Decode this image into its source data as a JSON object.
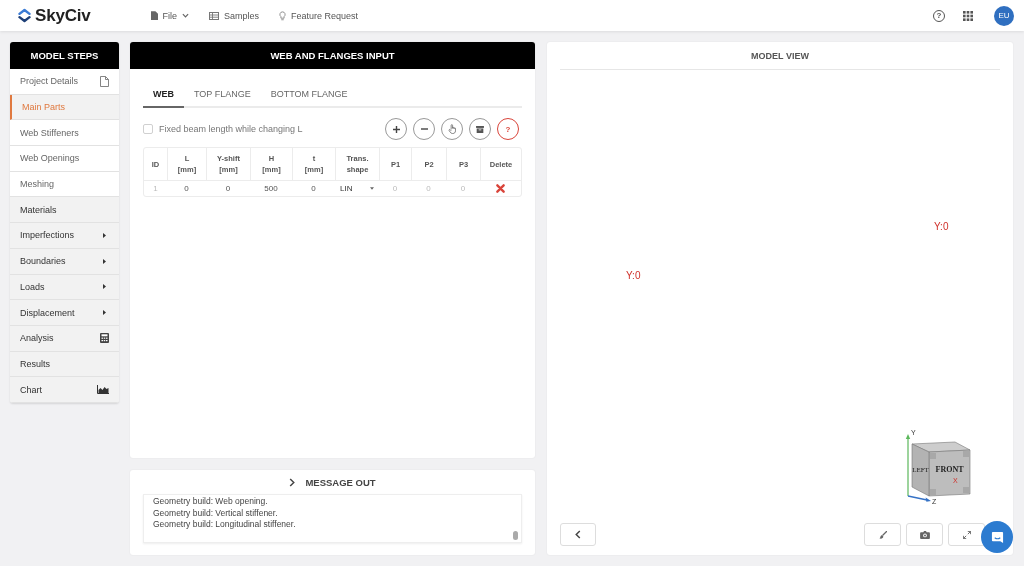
{
  "header": {
    "logo": "SkyCiv",
    "menu": [
      {
        "label": "File",
        "kind": "dropdown"
      },
      {
        "label": "Samples",
        "kind": "samples"
      },
      {
        "label": "Feature Request",
        "kind": "request"
      }
    ],
    "help": "?",
    "avatar": "EU"
  },
  "sidebar": {
    "title": "MODEL STEPS",
    "items": [
      {
        "label": "Project Details",
        "kind": "sub",
        "selected": false,
        "has_submenu": false
      },
      {
        "label": "Main Parts",
        "kind": "sub",
        "selected": true,
        "has_submenu": false
      },
      {
        "label": "Web Stiffeners",
        "kind": "sub",
        "selected": false,
        "has_submenu": false
      },
      {
        "label": "Web Openings",
        "kind": "sub",
        "selected": false,
        "has_submenu": false
      },
      {
        "label": "Meshing",
        "kind": "sub",
        "selected": false,
        "has_submenu": false
      },
      {
        "label": "Materials",
        "kind": "main",
        "selected": false,
        "has_submenu": false
      },
      {
        "label": "Imperfections",
        "kind": "main",
        "selected": false,
        "has_submenu": true
      },
      {
        "label": "Boundaries",
        "kind": "main",
        "selected": false,
        "has_submenu": true
      },
      {
        "label": "Loads",
        "kind": "main",
        "selected": false,
        "has_submenu": true
      },
      {
        "label": "Displacement",
        "kind": "main",
        "selected": false,
        "has_submenu": true
      },
      {
        "label": "Analysis",
        "kind": "main",
        "selected": false,
        "has_submenu": false
      },
      {
        "label": "Results",
        "kind": "main",
        "selected": false,
        "has_submenu": false
      },
      {
        "label": "Chart",
        "kind": "main",
        "selected": false,
        "has_submenu": false
      }
    ]
  },
  "input_panel": {
    "title": "WEB AND FLANGES INPUT",
    "tabs": [
      {
        "label": "WEB",
        "selected": true
      },
      {
        "label": "TOP FLANGE",
        "selected": false
      },
      {
        "label": "BOTTOM FLANGE",
        "selected": false
      }
    ],
    "fixed_length": {
      "label": "Fixed beam length while changing L",
      "checked": false
    },
    "help": "?",
    "table": {
      "columns": [
        "ID",
        "L\n[mm]",
        "Y-shift\n[mm]",
        "H\n[mm]",
        "t\n[mm]",
        "Trans.\nshape",
        "P1",
        "P2",
        "P3",
        "Delete"
      ],
      "rows": [
        {
          "cells": [
            {
              "kind": "text",
              "text": "1",
              "disabled": true
            },
            {
              "kind": "text",
              "text": "0",
              "disabled": false
            },
            {
              "kind": "text",
              "text": "0",
              "disabled": false
            },
            {
              "kind": "text",
              "text": "500",
              "disabled": false
            },
            {
              "kind": "text",
              "text": "0",
              "disabled": false
            },
            {
              "kind": "select",
              "text": "LIN"
            },
            {
              "kind": "text",
              "text": "0",
              "disabled": true
            },
            {
              "kind": "text",
              "text": "0",
              "disabled": true
            },
            {
              "kind": "text",
              "text": "0",
              "disabled": true
            },
            {
              "kind": "delete"
            }
          ]
        }
      ]
    }
  },
  "message_panel": {
    "title": "MESSAGE OUT",
    "lines": [
      "Geometry build: Web opening.",
      "Geometry build: Vertical stiffener.",
      "Geometry build: Longitudinal stiffener."
    ]
  },
  "model_view": {
    "title": "MODEL VIEW",
    "labels": [
      "Y:0",
      "Y:0"
    ],
    "cube": {
      "left": "LEFT",
      "front": "FRONT"
    },
    "axes": [
      "Y",
      "Z",
      "X"
    ]
  }
}
